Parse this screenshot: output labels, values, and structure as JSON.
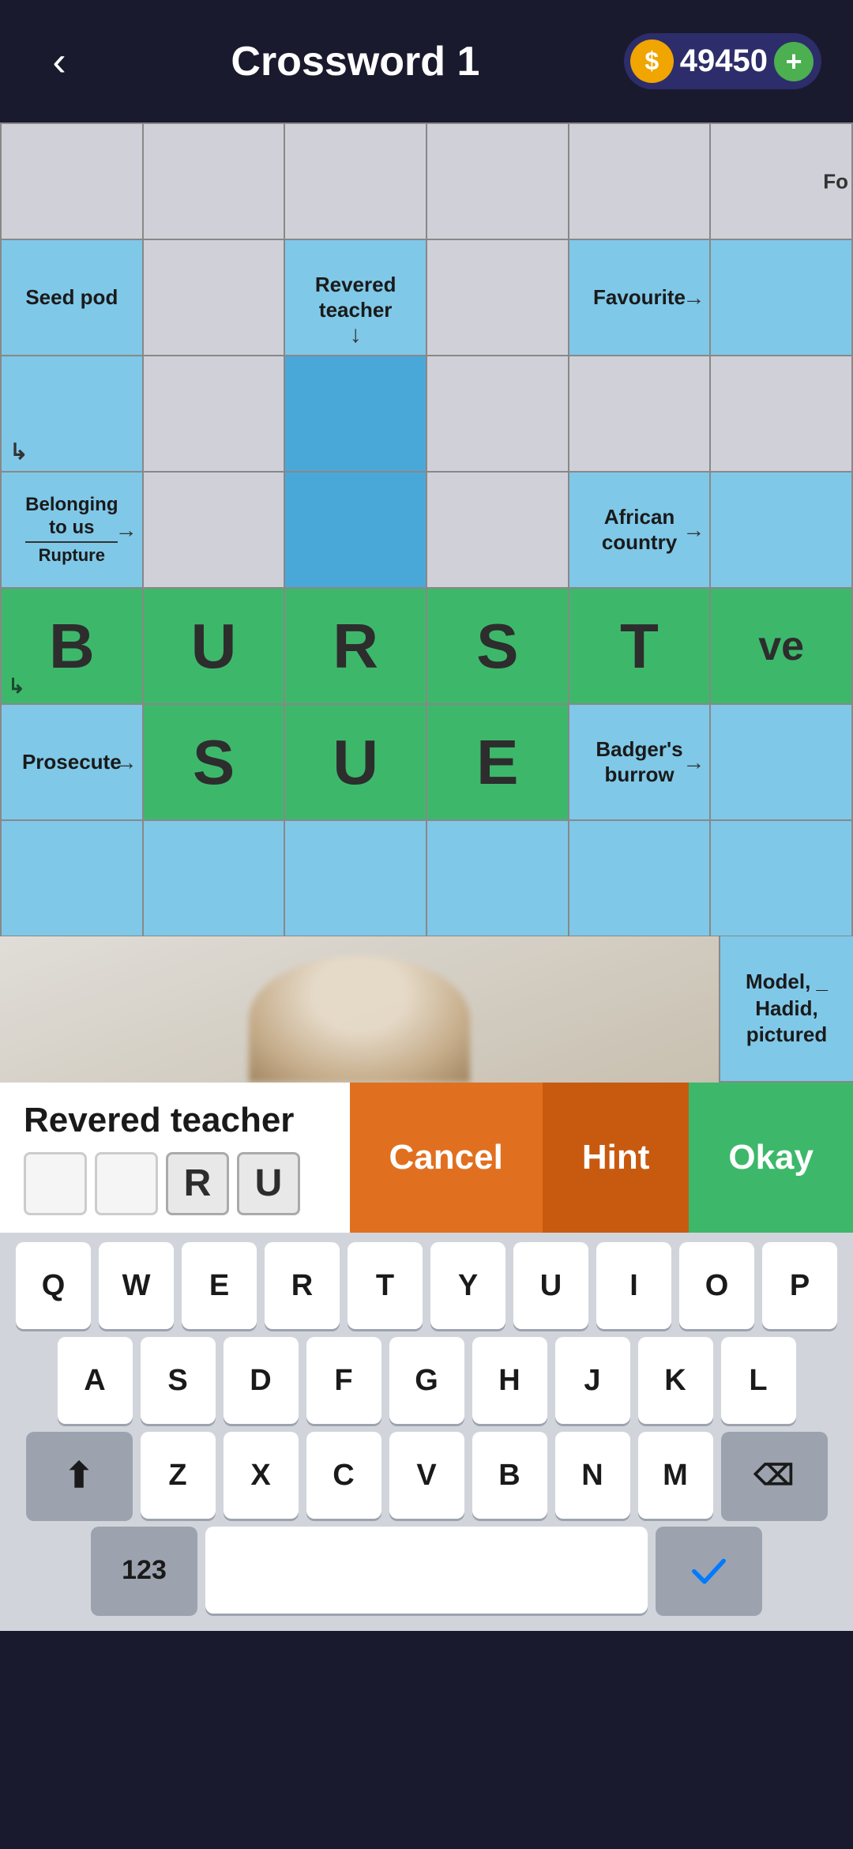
{
  "header": {
    "back_label": "‹",
    "title": "Crossword 1",
    "coin_icon": "💰",
    "coin_amount": "49450",
    "plus_label": "+"
  },
  "grid": {
    "rows": 7,
    "cols": 6,
    "clues": {
      "seed_pod": "Seed pod",
      "revered_teacher": "Revered teacher",
      "favourite": "Favourite",
      "belonging_to_us": "Belonging to us",
      "rupture": "Rupture",
      "african_country": "African country",
      "prosecute": "Prosecute",
      "badgers_burrow": "Badger's burrow",
      "model_hadid": "Model, _\nHadid,\npictured",
      "truncated_fo": "Fo"
    },
    "letters": {
      "row4_col0": "B",
      "row4_col1": "U",
      "row4_col2": "R",
      "row4_col3": "S",
      "row4_col4": "T",
      "row4_col5": "ve",
      "row5_col1": "S",
      "row5_col2": "U",
      "row5_col3": "E"
    }
  },
  "clue_bar": {
    "clue_text": "Revered teacher",
    "letter_boxes": [
      {
        "label": "",
        "state": "empty"
      },
      {
        "label": "",
        "state": "empty"
      },
      {
        "label": "R",
        "state": "filled"
      },
      {
        "label": "U",
        "state": "filled"
      }
    ],
    "cancel_label": "Cancel",
    "hint_label": "Hint",
    "okay_label": "Okay"
  },
  "keyboard": {
    "row1": [
      "Q",
      "W",
      "E",
      "R",
      "T",
      "Y",
      "U",
      "I",
      "O",
      "P"
    ],
    "row2": [
      "A",
      "S",
      "D",
      "F",
      "G",
      "H",
      "J",
      "K",
      "L"
    ],
    "row3_left": "⬆",
    "row3_mid": [
      "Z",
      "X",
      "C",
      "V",
      "B",
      "N",
      "M"
    ],
    "row3_right": "⌫",
    "row4_left": "123",
    "row4_space": "",
    "row4_right": "✓"
  }
}
